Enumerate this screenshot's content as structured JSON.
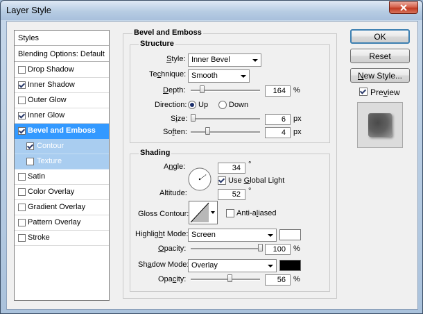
{
  "window": {
    "title": "Layer Style"
  },
  "style_list": {
    "header": "Styles",
    "blending": "Blending Options: Default",
    "items": [
      {
        "label": "Drop Shadow",
        "checked": false
      },
      {
        "label": "Inner Shadow",
        "checked": true
      },
      {
        "label": "Outer Glow",
        "checked": false
      },
      {
        "label": "Inner Glow",
        "checked": true
      },
      {
        "label": "Bevel and Emboss",
        "checked": true,
        "selected": true
      },
      {
        "label": "Contour",
        "checked": true,
        "sub": true
      },
      {
        "label": "Texture",
        "checked": false,
        "sub": true
      },
      {
        "label": "Satin",
        "checked": false
      },
      {
        "label": "Color Overlay",
        "checked": false
      },
      {
        "label": "Gradient Overlay",
        "checked": false
      },
      {
        "label": "Pattern Overlay",
        "checked": false
      },
      {
        "label": "Stroke",
        "checked": false
      }
    ]
  },
  "bevel": {
    "group_title": "Bevel and Emboss",
    "structure": {
      "title": "Structure",
      "style_label": "Style:",
      "style_value": "Inner Bevel",
      "technique_label": "Technique:",
      "technique_value": "Smooth",
      "depth_label": "Depth:",
      "depth_value": "164",
      "depth_unit": "%",
      "depth_slider": 0.16,
      "direction_label": "Direction:",
      "direction_up": "Up",
      "direction_down": "Down",
      "direction_selected": "Up",
      "size_label": "Size:",
      "size_value": "6",
      "size_unit": "px",
      "size_slider": 0.03,
      "soften_label": "Soften:",
      "soften_value": "4",
      "soften_unit": "px",
      "soften_slider": 0.24
    },
    "shading": {
      "title": "Shading",
      "angle_label": "Angle:",
      "angle_value": "34",
      "angle_unit": "°",
      "global_light_label": "Use Global Light",
      "global_light_checked": true,
      "altitude_label": "Altitude:",
      "altitude_value": "52",
      "altitude_unit": "°",
      "gloss_label": "Gloss Contour:",
      "anti_aliased_label": "Anti-aliased",
      "anti_aliased_checked": false,
      "highlight_label": "Highlight Mode:",
      "highlight_value": "Screen",
      "highlight_color": "#ffffff",
      "highlight_opacity_label": "Opacity:",
      "highlight_opacity": "100",
      "highlight_opacity_unit": "%",
      "highlight_slider": 1.0,
      "shadow_label": "Shadow Mode:",
      "shadow_value": "Overlay",
      "shadow_color": "#000000",
      "shadow_opacity_label": "Opacity:",
      "shadow_opacity": "56",
      "shadow_opacity_unit": "%",
      "shadow_slider": 0.56
    }
  },
  "buttons": {
    "ok": "OK",
    "reset": "Reset",
    "new_style": "New Style...",
    "preview_label": "Preview",
    "preview_checked": true
  }
}
